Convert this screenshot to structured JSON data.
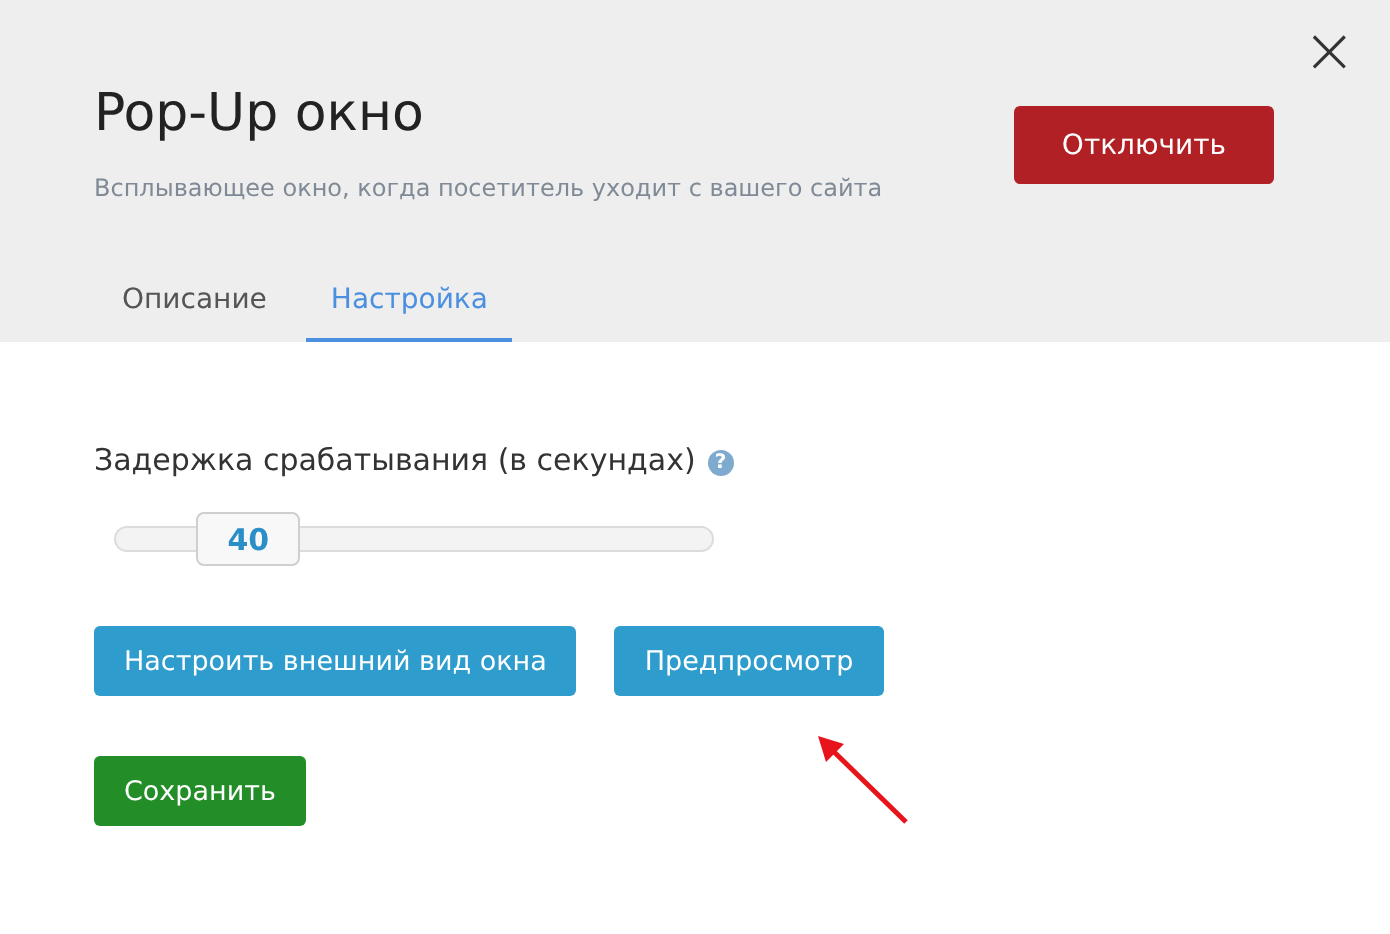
{
  "header": {
    "title": "Pop-Up окно",
    "subtitle": "Всплывающее окно, когда посетитель уходит с вашего сайта",
    "disable_button": "Отключить",
    "close": "×"
  },
  "tabs": [
    {
      "label": "Описание",
      "selected": false
    },
    {
      "label": "Настройка",
      "selected": true
    }
  ],
  "delay": {
    "label": "Задержка срабатывания (в секундах)",
    "help": "?",
    "value": "40",
    "level": 0.17
  },
  "buttons": [
    {
      "label": "Настроить внешний вид окна",
      "kind": "primary"
    },
    {
      "label": "Предпросмотр",
      "kind": "primary"
    },
    {
      "label": "Сохранить",
      "kind": "save"
    }
  ]
}
